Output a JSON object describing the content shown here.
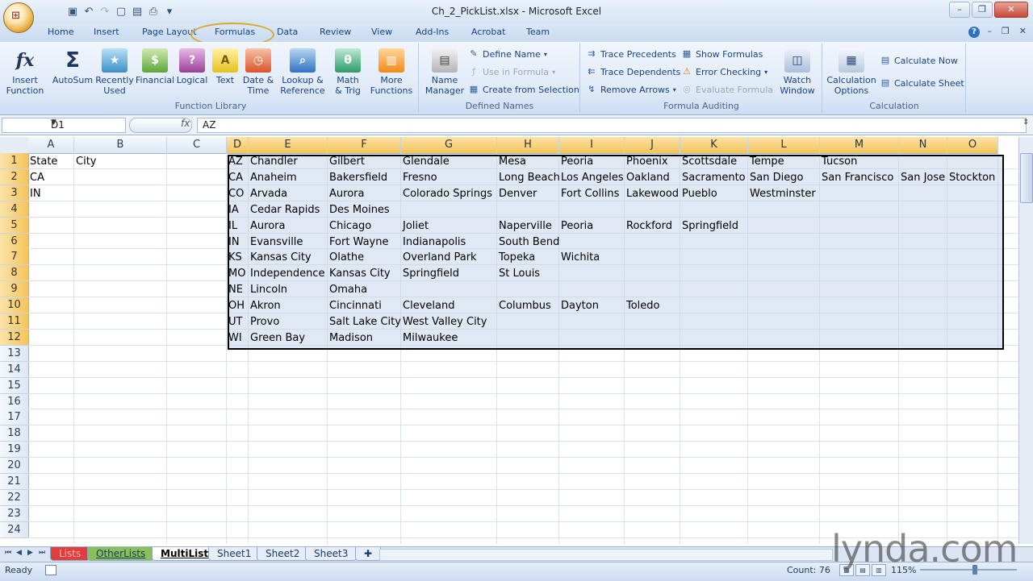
{
  "window": {
    "title": "Ch_2_PickList.xlsx - Microsoft Excel"
  },
  "tabs": [
    "Home",
    "Insert",
    "Page Layout",
    "Formulas",
    "Data",
    "Review",
    "View",
    "Add-Ins",
    "Acrobat",
    "Team"
  ],
  "active_tab": "Formulas",
  "ribbon": {
    "function_library": {
      "label": "Function Library",
      "insert_function": "Insert\nFunction",
      "autosum": "AutoSum",
      "recently_used": "Recently\nUsed",
      "financial": "Financial",
      "logical": "Logical",
      "text": "Text",
      "date_time": "Date &\nTime",
      "lookup_reference": "Lookup &\nReference",
      "math_trig": "Math\n& Trig",
      "more_functions": "More\nFunctions"
    },
    "defined_names": {
      "label": "Defined Names",
      "name_manager": "Name\nManager",
      "define_name": "Define Name",
      "use_in_formula": "Use in Formula",
      "create_from_selection": "Create from Selection"
    },
    "formula_auditing": {
      "label": "Formula Auditing",
      "trace_precedents": "Trace Precedents",
      "trace_dependents": "Trace Dependents",
      "remove_arrows": "Remove Arrows",
      "show_formulas": "Show Formulas",
      "error_checking": "Error Checking",
      "evaluate_formula": "Evaluate Formula",
      "watch_window": "Watch\nWindow"
    },
    "calculation": {
      "label": "Calculation",
      "calculation_options": "Calculation\nOptions",
      "calculate_now": "Calculate Now",
      "calculate_sheet": "Calculate Sheet"
    }
  },
  "formula_bar": {
    "name_box": "D1",
    "fx": "fx",
    "formula": "AZ"
  },
  "grid": {
    "columns": [
      "A",
      "B",
      "C",
      "D",
      "E",
      "F",
      "G",
      "H",
      "I",
      "J",
      "K",
      "L",
      "M",
      "N",
      "O"
    ],
    "selected_columns": [
      "D",
      "E",
      "F",
      "G",
      "H",
      "I",
      "J",
      "K",
      "L",
      "M",
      "N",
      "O"
    ],
    "rows": [
      "1",
      "2",
      "3",
      "4",
      "5",
      "6",
      "7",
      "8",
      "9",
      "10",
      "11",
      "12",
      "13",
      "14",
      "15",
      "16",
      "17",
      "18",
      "19",
      "20",
      "21",
      "22",
      "23",
      "24"
    ],
    "selected_rows": [
      "1",
      "2",
      "3",
      "4",
      "5",
      "6",
      "7",
      "8",
      "9",
      "10",
      "11",
      "12"
    ],
    "cells_ab": [
      [
        "State",
        "City"
      ],
      [
        "CA",
        ""
      ],
      [
        "IN",
        ""
      ]
    ],
    "table": [
      [
        "AZ",
        "Chandler",
        "Gilbert",
        "Glendale",
        "Mesa",
        "Peoria",
        "Phoenix",
        "Scottsdale",
        "Tempe",
        "Tucson",
        "",
        ""
      ],
      [
        "CA",
        "Anaheim",
        "Bakersfield",
        "Fresno",
        "Long Beach",
        "Los Angeles",
        "Oakland",
        "Sacramento",
        "San Diego",
        "San Francisco",
        "San Jose",
        "Stockton"
      ],
      [
        "CO",
        "Arvada",
        "Aurora",
        "Colorado Springs",
        "Denver",
        "Fort Collins",
        "Lakewood",
        "Pueblo",
        "Westminster",
        "",
        "",
        ""
      ],
      [
        "IA",
        "Cedar Rapids",
        "Des Moines",
        "",
        "",
        "",
        "",
        "",
        "",
        "",
        "",
        ""
      ],
      [
        "IL",
        "Aurora",
        "Chicago",
        "Joliet",
        "Naperville",
        "Peoria",
        "Rockford",
        "Springfield",
        "",
        "",
        "",
        ""
      ],
      [
        "IN",
        "Evansville",
        "Fort Wayne",
        "Indianapolis",
        "South Bend",
        "",
        "",
        "",
        "",
        "",
        "",
        ""
      ],
      [
        "KS",
        "Kansas City",
        "Olathe",
        "Overland Park",
        "Topeka",
        "Wichita",
        "",
        "",
        "",
        "",
        "",
        ""
      ],
      [
        "MO",
        "Independence",
        "Kansas City",
        "Springfield",
        "St Louis",
        "",
        "",
        "",
        "",
        "",
        "",
        ""
      ],
      [
        "NE",
        "Lincoln",
        "Omaha",
        "",
        "",
        "",
        "",
        "",
        "",
        "",
        "",
        ""
      ],
      [
        "OH",
        "Akron",
        "Cincinnati",
        "Cleveland",
        "Columbus",
        "Dayton",
        "Toledo",
        "",
        "",
        "",
        "",
        ""
      ],
      [
        "UT",
        "Provo",
        "Salt Lake City",
        "West Valley City",
        "",
        "",
        "",
        "",
        "",
        "",
        "",
        ""
      ],
      [
        "WI",
        "Green Bay",
        "Madison",
        "Milwaukee",
        "",
        "",
        "",
        "",
        "",
        "",
        "",
        ""
      ]
    ]
  },
  "sheets": [
    {
      "name": "Lists",
      "style": "red"
    },
    {
      "name": "OtherLists",
      "style": "green"
    },
    {
      "name": "MultiList",
      "style": "active"
    },
    {
      "name": "Sheet1",
      "style": ""
    },
    {
      "name": "Sheet2",
      "style": ""
    },
    {
      "name": "Sheet3",
      "style": ""
    }
  ],
  "status": {
    "ready": "Ready",
    "count": "Count: 76",
    "zoom": "115%"
  },
  "watermark": "lynda.com"
}
